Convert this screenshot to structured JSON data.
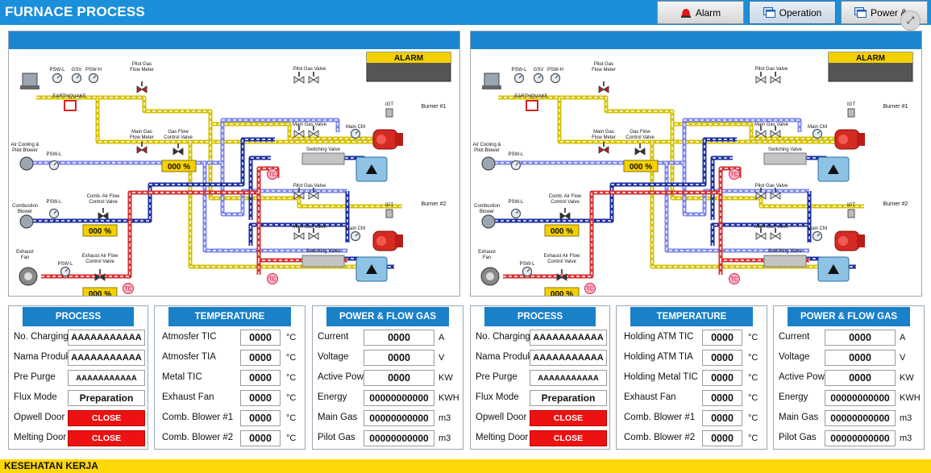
{
  "app": {
    "title": "FURNACE PROCESS"
  },
  "nav": {
    "alarm": "Alarm",
    "operation": "Operation",
    "power": "Power &"
  },
  "colors": {
    "header": "#1c8fdb",
    "pipe_yellow": "#d5c100",
    "pipe_blue": "#1a2ca0",
    "pipe_red": "#d43030",
    "alarm_box": "#f5d000",
    "close_red": "#ee1111",
    "footer": "#ffd80a"
  },
  "diagram": {
    "alarm": "ALARM",
    "psw_l": "PSW-L",
    "gsv": "GSV",
    "psw_h": "PSW-H",
    "pilot_gas_flow_meter": [
      "Pilot Gas",
      "Flow Meter"
    ],
    "main_gas_flow_meter": [
      "Main Gas",
      "Flow Meter"
    ],
    "gas_flow_control_valve": [
      "Gas Flow",
      "Control Valve"
    ],
    "earthquake": "EARTHQUAKE",
    "air_cooling": [
      "Air Cooling &",
      "Pilot Blower"
    ],
    "combustion_blower": [
      "Combustion",
      "Blower"
    ],
    "comb_air_flow": [
      "Comb. Air Flow",
      "Control Valve"
    ],
    "exhaust_fan": [
      "Exhaust",
      "Fan"
    ],
    "exhaust_air_flow": [
      "Exhaust Air Flow",
      "Control Valve"
    ],
    "pilot_gas_valve": "Pilot Gas Valve",
    "main_gas_valve": "Main Gas Valve",
    "switching_valve": "Switching Valve",
    "main_cm": "Main CM",
    "igt": "IGT",
    "burner1": "Burner #1",
    "burner2": "Burner #2",
    "tc": "TC",
    "pct_gas": "000 %",
    "pct_comb": "000 %",
    "pct_exh": "000 %"
  },
  "left": {
    "process": {
      "title": "PROCESS",
      "rows": [
        {
          "label": "No. Charging",
          "value": "AAAAAAAAAAA"
        },
        {
          "label": "Nama Produk",
          "value": "AAAAAAAAAAA"
        },
        {
          "label": "Pre Purge",
          "value": "AAAAAAAAAAA"
        },
        {
          "label": "Flux Mode",
          "value": "Preparation"
        },
        {
          "label": "Opwell Door",
          "value": "CLOSE"
        },
        {
          "label": "Melting Door",
          "value": "CLOSE"
        }
      ]
    },
    "temperature": {
      "title": "TEMPERATURE",
      "rows": [
        {
          "label": "Atmosfer TIC",
          "value": "0000",
          "unit": "°C"
        },
        {
          "label": "Atmosfer TIA",
          "value": "0000",
          "unit": "°C"
        },
        {
          "label": "Metal TIC",
          "value": "0000",
          "unit": "°C"
        },
        {
          "label": "Exhaust Fan",
          "value": "0000",
          "unit": "°C"
        },
        {
          "label": "Comb. Blower #1",
          "value": "0000",
          "unit": "°C"
        },
        {
          "label": "Comb. Blower #2",
          "value": "0000",
          "unit": "°C"
        }
      ]
    },
    "power": {
      "title": "POWER & FLOW GAS",
      "rows": [
        {
          "label": "Current",
          "value": "0000",
          "unit": "A"
        },
        {
          "label": "Voltage",
          "value": "0000",
          "unit": "V"
        },
        {
          "label": "Active Power",
          "value": "0000",
          "unit": "KW"
        },
        {
          "label": "Energy",
          "value": "00000000000",
          "unit": "KWH"
        },
        {
          "label": "Main Gas",
          "value": "00000000000",
          "unit": "m3"
        },
        {
          "label": "Pilot Gas",
          "value": "00000000000",
          "unit": "m3"
        }
      ]
    }
  },
  "right": {
    "process": {
      "title": "PROCESS",
      "rows": [
        {
          "label": "No. Charging",
          "value": "AAAAAAAAAAA"
        },
        {
          "label": "Nama Produk",
          "value": "AAAAAAAAAAA"
        },
        {
          "label": "Pre Purge",
          "value": "AAAAAAAAAAA"
        },
        {
          "label": "Flux Mode",
          "value": "Preparation"
        },
        {
          "label": "Opwell Door",
          "value": "CLOSE"
        },
        {
          "label": "Melting Door",
          "value": "CLOSE"
        }
      ]
    },
    "temperature": {
      "title": "TEMPERATURE",
      "rows": [
        {
          "label": "Holding ATM TIC",
          "value": "0000",
          "unit": "°C"
        },
        {
          "label": "Holding ATM TIA",
          "value": "0000",
          "unit": "°C"
        },
        {
          "label": "Holding Metal TIC",
          "value": "0000",
          "unit": "°C"
        },
        {
          "label": "Exhaust Fan",
          "value": "0000",
          "unit": "°C"
        },
        {
          "label": "Comb. Blower #1",
          "value": "0000",
          "unit": "°C"
        },
        {
          "label": "Comb. Blower #2",
          "value": "0000",
          "unit": "°C"
        }
      ]
    },
    "power": {
      "title": "POWER & FLOW GAS",
      "rows": [
        {
          "label": "Current",
          "value": "0000",
          "unit": "A"
        },
        {
          "label": "Voltage",
          "value": "0000",
          "unit": "V"
        },
        {
          "label": "Active Power",
          "value": "0000",
          "unit": "KW"
        },
        {
          "label": "Energy",
          "value": "00000000000",
          "unit": "KWH"
        },
        {
          "label": "Main Gas",
          "value": "00000000000",
          "unit": "m3"
        },
        {
          "label": "Pilot Gas",
          "value": "00000000000",
          "unit": "m3"
        }
      ]
    }
  },
  "footer": {
    "text": "KESEHATAN KERJA"
  }
}
